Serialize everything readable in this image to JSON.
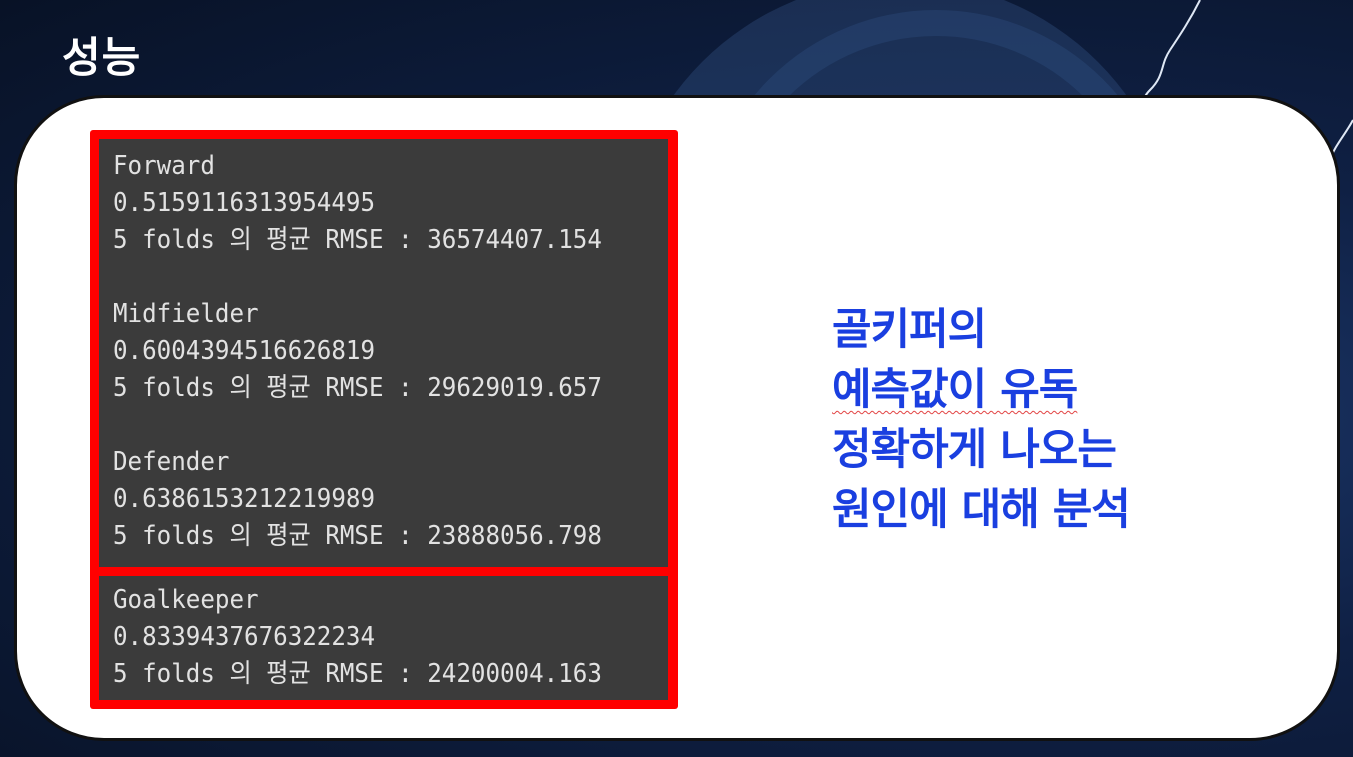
{
  "slide": {
    "title": "성능"
  },
  "console": {
    "groups": [
      {
        "position": "Forward",
        "score": "0.5159116313954495",
        "rmse_line": "5 folds 의 평균 RMSE : 36574407.154"
      },
      {
        "position": "Midfielder",
        "score": "0.6004394516626819",
        "rmse_line": "5 folds 의 평균 RMSE : 29629019.657"
      },
      {
        "position": "Defender",
        "score": "0.6386153212219989",
        "rmse_line": "5 folds 의 평균 RMSE : 23888056.798"
      },
      {
        "position": "Goalkeeper",
        "score": "0.8339437676322234",
        "rmse_line": "5 folds 의 평균 RMSE : 24200004.163"
      }
    ]
  },
  "note": {
    "lines": [
      "골키퍼의",
      "예측값이 유독",
      "정확하게 나오는",
      "원인에 대해 분석"
    ]
  },
  "colors": {
    "highlight_border": "#ff0000",
    "note_text": "#1a3fe0",
    "console_bg": "#3b3b3b",
    "background": "#0f2044"
  }
}
